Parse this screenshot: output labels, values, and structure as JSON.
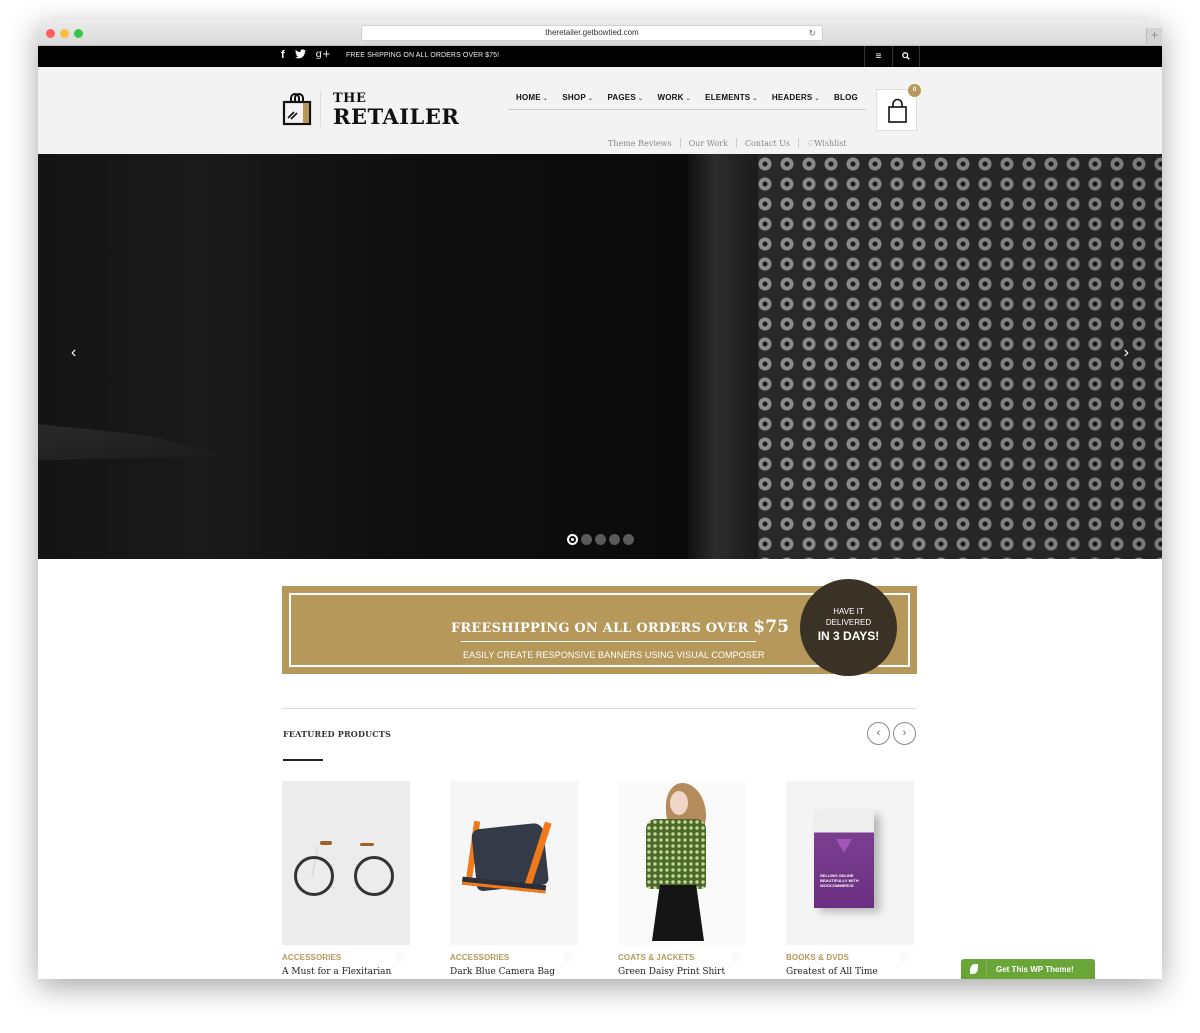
{
  "browser": {
    "url": "theretailer.getbowtied.com",
    "reload_icon": "↻",
    "newtab_icon": "+"
  },
  "topbar": {
    "social": [
      {
        "name": "facebook-icon",
        "glyph": "f"
      },
      {
        "name": "twitter-icon",
        "glyph": "🐦"
      },
      {
        "name": "google-plus-icon",
        "glyph": "g+"
      }
    ],
    "promo": "FREE SHIPPING ON ALL ORDERS OVER $75!",
    "menu_icon": "≡",
    "search_icon": "⌕"
  },
  "header": {
    "logo_top": "THE",
    "logo_bottom": "RETAILER",
    "nav": [
      {
        "label": "HOME",
        "dropdown": true
      },
      {
        "label": "SHOP",
        "dropdown": true
      },
      {
        "label": "PAGES",
        "dropdown": true
      },
      {
        "label": "WORK",
        "dropdown": true
      },
      {
        "label": "ELEMENTS",
        "dropdown": true
      },
      {
        "label": "HEADERS",
        "dropdown": true
      },
      {
        "label": "BLOG",
        "dropdown": false
      }
    ],
    "chevron": "⌄",
    "subnav": [
      "Theme Reviews",
      "Our Work",
      "Contact Us",
      "♡Wishlist"
    ],
    "cart_count": "0"
  },
  "hero": {
    "prev": "‹",
    "next": "›",
    "slide_count": 5,
    "active_slide": 1
  },
  "banner": {
    "title": "FREESHIPPING ON ALL ORDERS OVER ",
    "price": "$75",
    "subtitle": "EASILY CREATE RESPONSIVE BANNERS USING VISUAL COMPOSER",
    "badge_line1": "HAVE IT",
    "badge_line2": "DELIVERED",
    "badge_line3": "IN 3 DAYS!",
    "accent": "#b5985a",
    "badge_color": "#3b3226"
  },
  "featured": {
    "title": "FEATURED PRODUCTS",
    "prev": "‹",
    "next": "›",
    "products": [
      {
        "category": "ACCESSORIES",
        "name": "A Must for a Flexitarian",
        "image": "bicycle"
      },
      {
        "category": "ACCESSORIES",
        "name": "Dark Blue Camera Bag",
        "image": "camera-bag"
      },
      {
        "category": "COATS & JACKETS",
        "name": "Green Daisy Print Shirt",
        "image": "model-shirt"
      },
      {
        "category": "BOOKS & DVDS",
        "name": "Greatest of All Time",
        "image": "book"
      }
    ],
    "book_cover_text": "SELLING ONLINE BEAUTIFULLY WITH WOOCOMMERCE",
    "heart": "♡"
  },
  "wp_button": {
    "label": "Get This WP Theme!",
    "color": "#6aa538"
  }
}
